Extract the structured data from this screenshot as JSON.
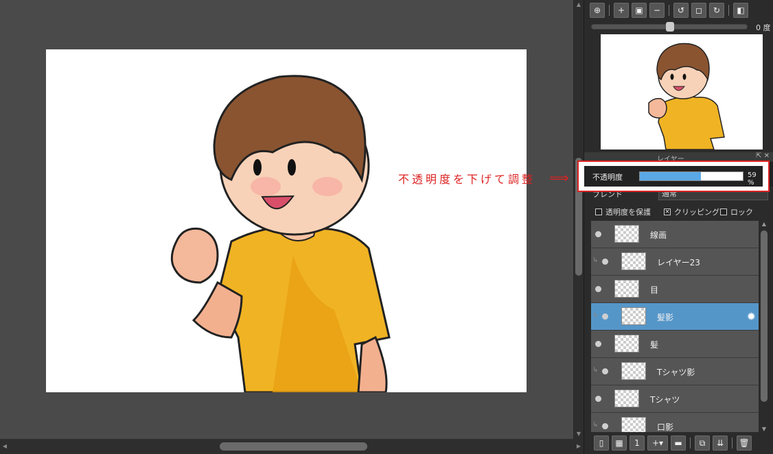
{
  "navigator": {
    "rotation_label": "0 度",
    "rotation_fraction": 0.5
  },
  "layer_panel": {
    "title": "レイヤー",
    "opacity_label": "不透明度",
    "opacity_value": 59,
    "opacity_text": "59 %",
    "blend_label": "ブレンド",
    "blend_value": "通常",
    "options": {
      "protect_opacity": "透明度を保護",
      "clipping": "クリッピング",
      "lock": "ロック"
    },
    "layers": [
      {
        "name": "線画",
        "clipped": false,
        "selected": false
      },
      {
        "name": "レイヤー23",
        "clipped": true,
        "selected": false
      },
      {
        "name": "目",
        "clipped": false,
        "selected": false
      },
      {
        "name": "髪影",
        "clipped": true,
        "selected": true
      },
      {
        "name": "髪",
        "clipped": false,
        "selected": false
      },
      {
        "name": "Tシャツ影",
        "clipped": true,
        "selected": false
      },
      {
        "name": "Tシャツ",
        "clipped": false,
        "selected": false
      },
      {
        "name": "口影",
        "clipped": true,
        "selected": false
      }
    ]
  },
  "annotation": {
    "text": "不透明度を下げて調整",
    "arrow": "⟹"
  },
  "colors": {
    "accent": "#5596c9",
    "annotation": "#dd2222",
    "opacity_fill": "#5aa8e6"
  }
}
